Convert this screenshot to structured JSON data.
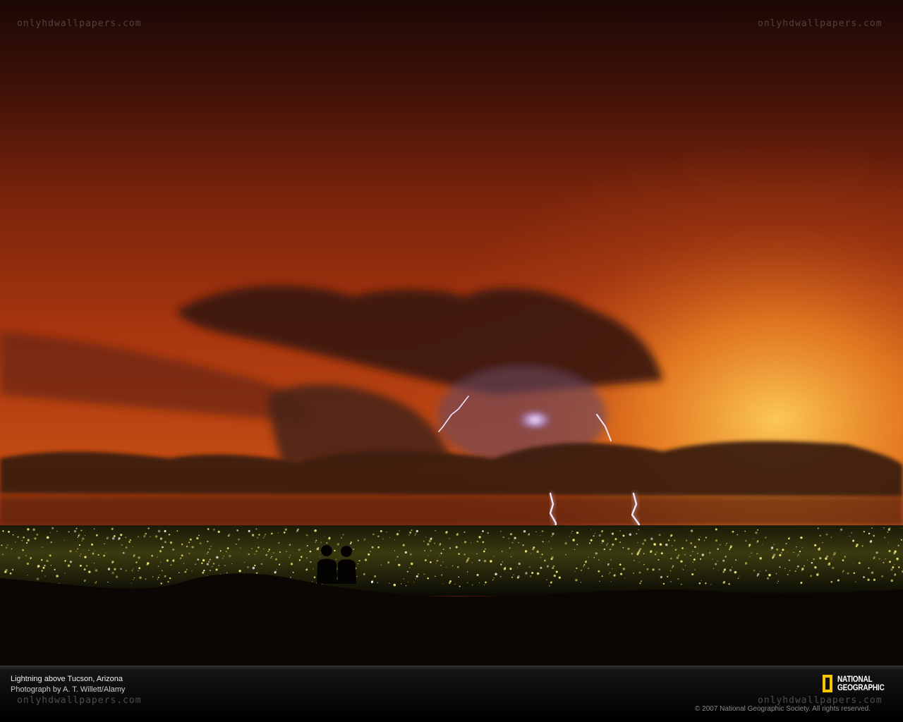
{
  "watermark": {
    "text": "onlyhdwallpapers.com"
  },
  "caption": {
    "title": "Lightning above Tucson, Arizona",
    "credit": "Photograph by A. T. Willett/Alamy"
  },
  "logo": {
    "line1": "NATIONAL",
    "line2": "GEOGRAPHIC",
    "accent_color": "#f6c700"
  },
  "copyright": "© 2007 National Geographic Society. All rights reserved.",
  "colors": {
    "sky_top": "#1a0805",
    "sky_mid": "#a8340e",
    "sky_glow": "#f2a02a",
    "city_lights": "#f3e87a",
    "lightning": "#f4e6ff"
  }
}
